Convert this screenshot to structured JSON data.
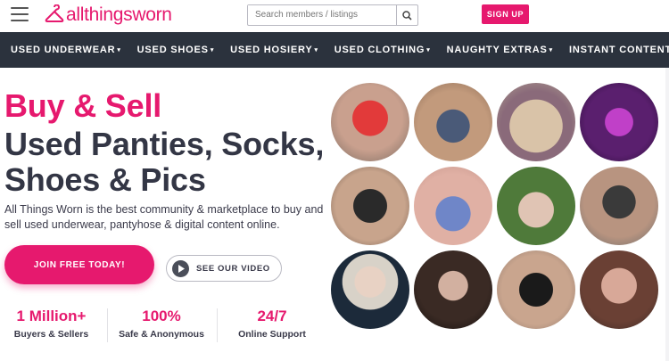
{
  "header": {
    "logo_text": "allthingsworn",
    "search_placeholder": "Search members / listings",
    "signup_label": "SIGN UP"
  },
  "nav": {
    "items": [
      {
        "label": "USED UNDERWEAR"
      },
      {
        "label": "USED SHOES"
      },
      {
        "label": "USED HOSIERY"
      },
      {
        "label": "USED CLOTHING"
      },
      {
        "label": "NAUGHTY EXTRAS"
      },
      {
        "label": "INSTANT CONTENT"
      }
    ],
    "caret": "▾"
  },
  "hero": {
    "headline_pink": "Buy & Sell",
    "headline_line1": "Used Panties, Socks,",
    "headline_line2": "Shoes & Pics",
    "description": "All Things Worn is the best community & marketplace to buy and sell used underwear, pantyhose & digital content online.",
    "join_label": "JOIN FREE TODAY!",
    "video_label": "SEE OUR VIDEO"
  },
  "stats": [
    {
      "value": "1 Million+",
      "label": "Buyers & Sellers"
    },
    {
      "value": "100%",
      "label": "Safe & Anonymous"
    },
    {
      "value": "24/7",
      "label": "Online Support"
    }
  ],
  "colors": {
    "brand_pink": "#e6196e",
    "nav_bg": "#2b323d",
    "text_dark": "#333645"
  },
  "icons": {
    "menu": "hamburger-menu-icon",
    "search": "search-icon",
    "video": "play-icon"
  },
  "gallery": {
    "count": 12
  }
}
